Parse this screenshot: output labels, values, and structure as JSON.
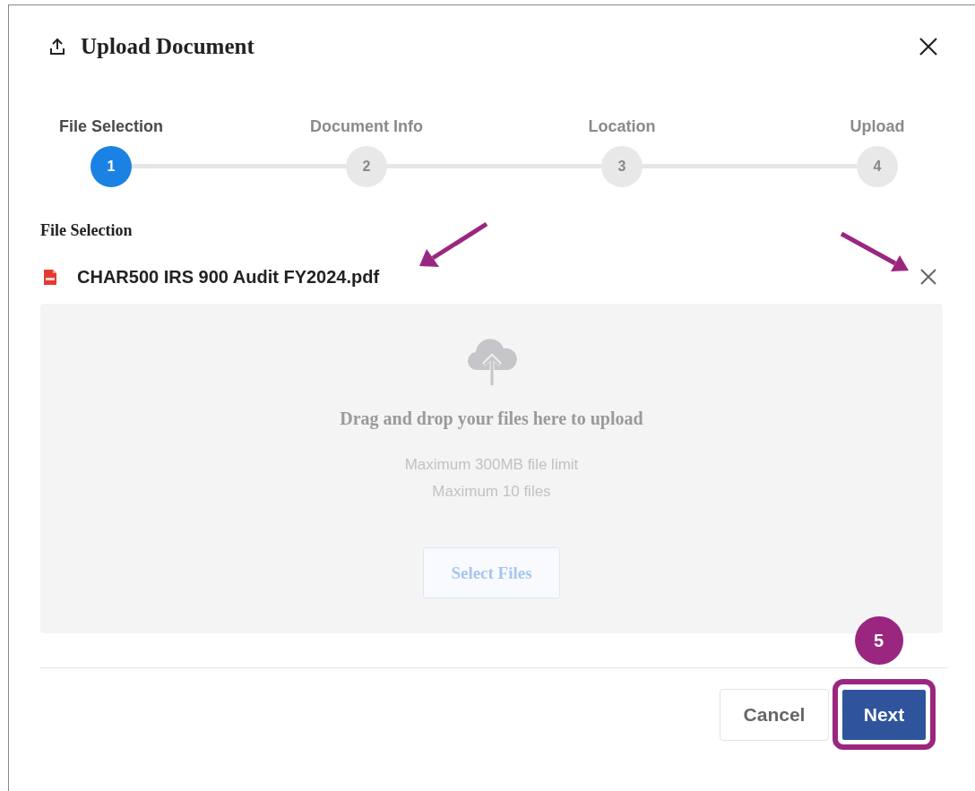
{
  "dialog": {
    "title": "Upload Document"
  },
  "steps": [
    {
      "number": "1",
      "label": "File Selection",
      "selected": true
    },
    {
      "number": "2",
      "label": "Document Info",
      "selected": false
    },
    {
      "number": "3",
      "label": "Location",
      "selected": false
    },
    {
      "number": "4",
      "label": "Upload",
      "selected": false
    }
  ],
  "section_title": "File Selection",
  "file": {
    "name": "CHAR500 IRS 900 Audit FY2024.pdf"
  },
  "drop_zone": {
    "heading": "Drag and drop your files here to upload",
    "limits": [
      "Maximum 300MB file limit",
      "Maximum 10 files"
    ],
    "button": "Select Files"
  },
  "buttons": [
    {
      "label": "Cancel",
      "kind": "secondary"
    },
    {
      "label": "Next",
      "kind": "primary"
    }
  ],
  "annotations": {
    "callout": "5"
  }
}
